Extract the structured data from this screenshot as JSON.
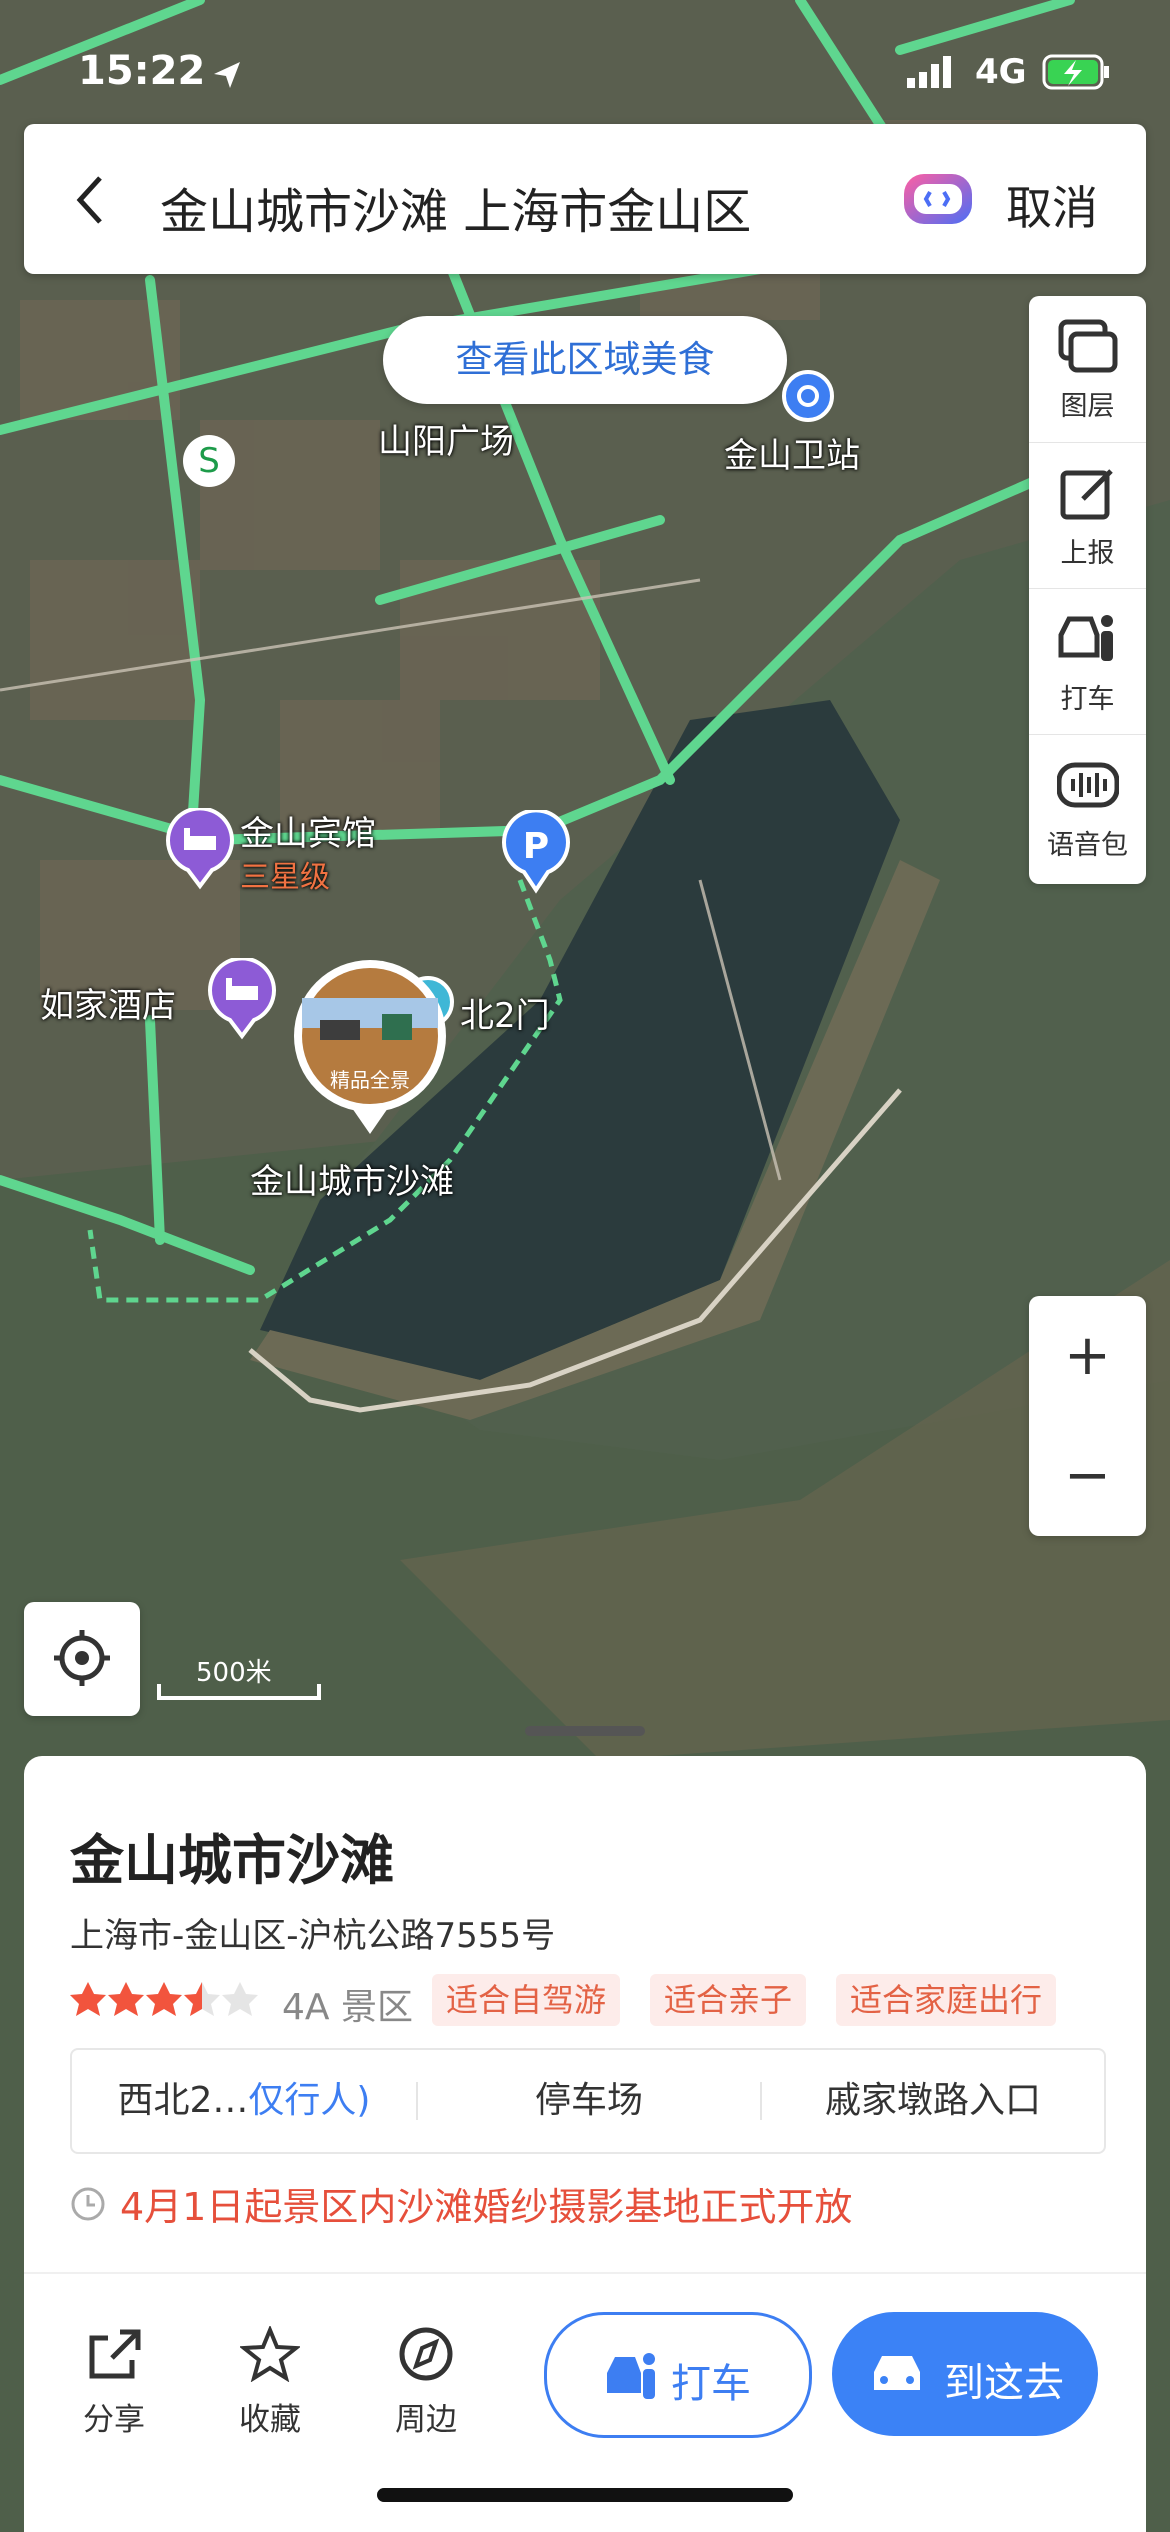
{
  "status": {
    "time": "15:22",
    "network": "4G"
  },
  "search": {
    "query": "金山城市沙滩 上海市金山区",
    "cancel": "取消"
  },
  "map": {
    "food_button": "查看此区域美食",
    "labels": {
      "square": "山阳广场",
      "station": "金山卫站",
      "hotel1": "金山宾馆",
      "hotel1_grade": "三星级",
      "hotel2": "如家酒店",
      "gate": "北2门",
      "beach": "金山城市沙滩",
      "panorama": "精品全景"
    },
    "scale": "500米"
  },
  "tools": [
    {
      "label": "图层",
      "icon": "layers-icon"
    },
    {
      "label": "上报",
      "icon": "report-icon"
    },
    {
      "label": "打车",
      "icon": "taxi-icon"
    },
    {
      "label": "语音包",
      "icon": "voice-icon"
    }
  ],
  "zoom": {
    "in": "+",
    "out": "−"
  },
  "place": {
    "title": "金山城市沙滩",
    "address": "上海市-金山区-沪杭公路7555号",
    "rating": 3.5,
    "level": "4A 景区",
    "tags": [
      "适合自驾游",
      "适合亲子",
      "适合家庭出行"
    ],
    "entrances": {
      "e1_text": "西北2…",
      "e1_link": "仅行人)",
      "e2": "停车场",
      "e3": "戚家墩路入口"
    },
    "notice": "4月1日起景区内沙滩婚纱摄影基地正式开放"
  },
  "actions": [
    {
      "label": "分享",
      "icon": "share-icon"
    },
    {
      "label": "收藏",
      "icon": "star-icon"
    },
    {
      "label": "周边",
      "icon": "compass-icon"
    }
  ],
  "buttons": {
    "taxi": "打车",
    "go": "到这去"
  },
  "colors": {
    "road": "#5fd68f",
    "accent": "#3b82f6",
    "notice": "#e64f3b",
    "star": "#f2543d"
  }
}
